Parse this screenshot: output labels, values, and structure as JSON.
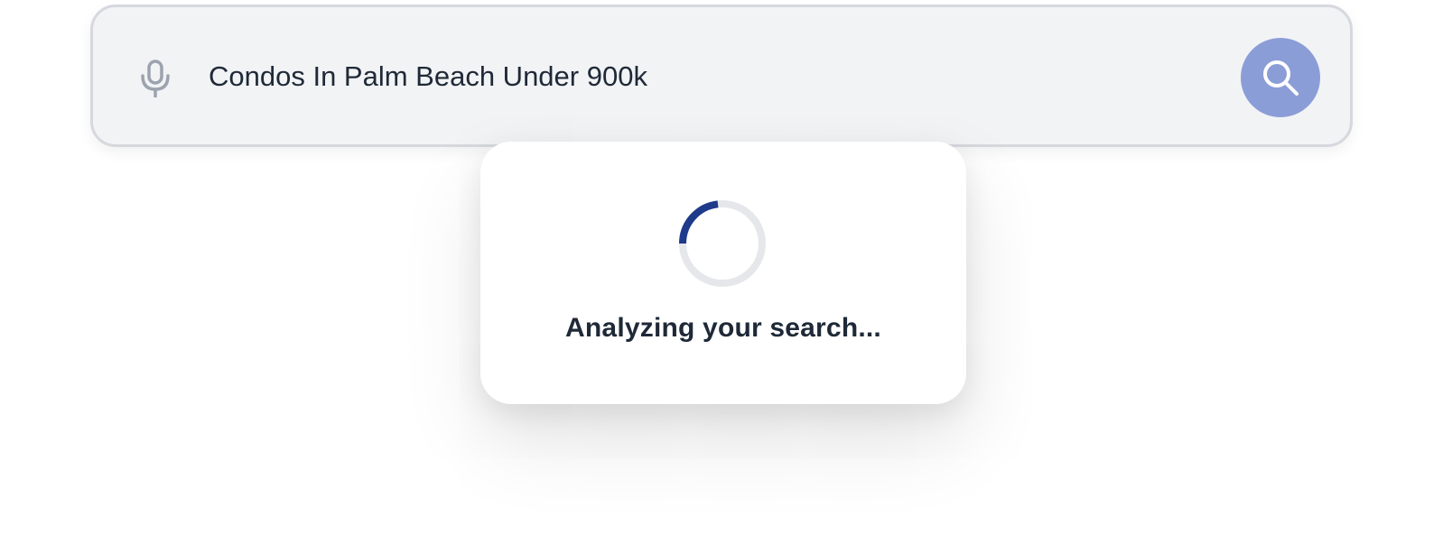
{
  "search": {
    "query": "Condos In Palm Beach Under 900k",
    "placeholder": "",
    "mic_icon": "microphone-icon",
    "button_icon": "search-icon",
    "button_color": "#8b9dd7"
  },
  "loading": {
    "message": "Analyzing your search...",
    "spinner_icon": "spinner-icon",
    "spinner_color": "#1e3a8a",
    "track_color": "#e5e7eb"
  }
}
